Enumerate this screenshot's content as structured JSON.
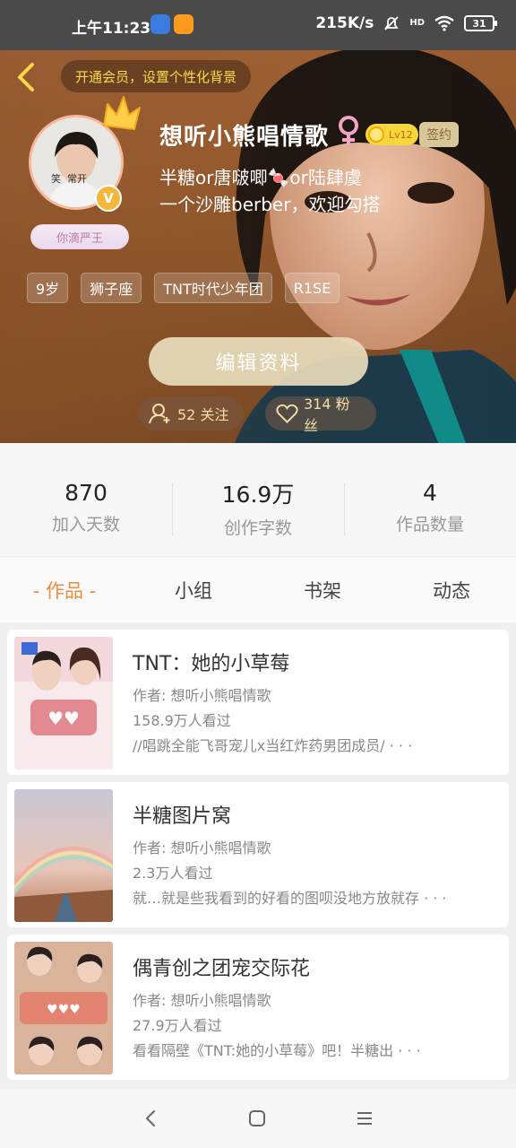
{
  "status_bar": {
    "time": "上午11:23",
    "network_speed": "215K/s",
    "signal": "HD",
    "battery": "31"
  },
  "header": {
    "vip_prompt": "开通会员，设置个性化背景",
    "avatar_caption": "笑  常开",
    "title_badge": "你滴严王",
    "verified": "V",
    "username": "想听小熊唱情歌",
    "level": "Lv12",
    "sign_badge": "签约",
    "bio_line1": "半糖or唐啵唧🍬or陆肆虞",
    "bio_line2": "一个沙雕berber，欢迎勾搭",
    "tags": [
      "9岁",
      "狮子座",
      "TNT时代少年团",
      "R1SE"
    ],
    "edit_button": "编辑资料",
    "follow_label": "52 关注",
    "fans_label": "314 粉丝"
  },
  "stats": [
    {
      "value": "870",
      "label": "加入天数"
    },
    {
      "value": "16.9万",
      "label": "创作字数"
    },
    {
      "value": "4",
      "label": "作品数量"
    }
  ],
  "tabs": [
    "- 作品 -",
    "小组",
    "书架",
    "动态"
  ],
  "works": [
    {
      "title": "TNT：她的小草莓",
      "author": "作者: 想听小熊唱情歌",
      "views": "158.9万人看过",
      "desc": "//唱跳全能飞哥宠儿x当红炸药男团成员/ · · ·"
    },
    {
      "title": "半糖图片窝",
      "author": "作者: 想听小熊唱情歌",
      "views": "2.3万人看过",
      "desc": "就…就是些我看到的好看的图呗没地方放就存 · · ·"
    },
    {
      "title": "偶青创之团宠交际花",
      "author": "作者: 想听小熊唱情歌",
      "views": "27.9万人看过",
      "desc": "看看隔壁《TNT:她的小草莓》吧！半糖出 · · ·"
    }
  ],
  "colors": {
    "accent": "#f08a3c",
    "vip_text": "#ffd84a",
    "header_bg": "#9c5e31"
  }
}
